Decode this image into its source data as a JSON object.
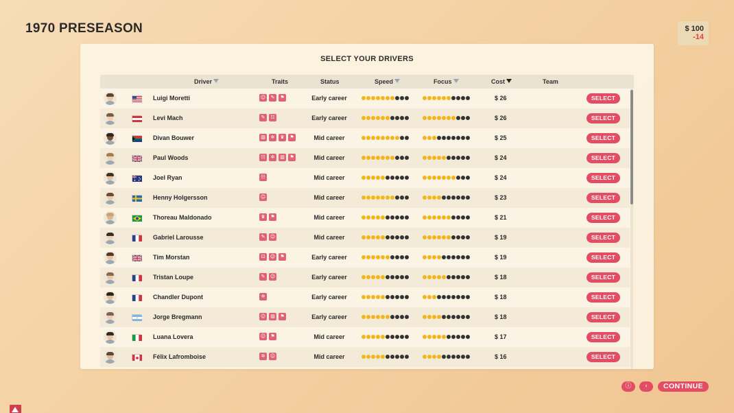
{
  "page": {
    "title": "1970 PRESEASON"
  },
  "money": {
    "balance": "$ 100",
    "delta": "-14",
    "delta_color": "#e53e3e"
  },
  "panel": {
    "title": "SELECT YOUR DRIVERS"
  },
  "columns": {
    "driver": "Driver",
    "traits": "Traits",
    "status": "Status",
    "speed": "Speed",
    "focus": "Focus",
    "cost": "Cost",
    "team": "Team"
  },
  "sort": {
    "active_column": "cost"
  },
  "select_label": "SELECT",
  "max_rating": 10,
  "accent_color": "#e34d63",
  "rating_on_color": "#f4b51c",
  "drivers": [
    {
      "name": "Luigi Moretti",
      "country": "USA",
      "traits": [
        "smile",
        "wrench",
        "flag"
      ],
      "status": "Early career",
      "speed": 7,
      "focus": 6,
      "cost": "$ 26"
    },
    {
      "name": "Levi Mach",
      "country": "Austria",
      "traits": [
        "wrench",
        "ghost"
      ],
      "status": "Early career",
      "speed": 6,
      "focus": 7,
      "cost": "$ 26"
    },
    {
      "name": "Divan Bouwer",
      "country": "South Africa",
      "traits": [
        "chart",
        "gear",
        "trophy",
        "flag"
      ],
      "status": "Mid career",
      "speed": 8,
      "focus": 3,
      "cost": "$ 25"
    },
    {
      "name": "Paul Woods",
      "country": "UK",
      "traits": [
        "ghost",
        "gear",
        "chart",
        "flag"
      ],
      "status": "Mid career",
      "speed": 7,
      "focus": 5,
      "cost": "$ 24"
    },
    {
      "name": "Joel Ryan",
      "country": "Australia",
      "traits": [
        "ghost"
      ],
      "status": "Mid career",
      "speed": 5,
      "focus": 7,
      "cost": "$ 24"
    },
    {
      "name": "Henny Holgersson",
      "country": "Sweden",
      "traits": [
        "smile"
      ],
      "status": "Mid career",
      "speed": 7,
      "focus": 4,
      "cost": "$ 23"
    },
    {
      "name": "Thoreau Maldonado",
      "country": "Brazil",
      "traits": [
        "trophy",
        "flag"
      ],
      "status": "Mid career",
      "speed": 5,
      "focus": 6,
      "cost": "$ 21"
    },
    {
      "name": "Gabriel Larousse",
      "country": "France",
      "traits": [
        "wrench",
        "smile"
      ],
      "status": "Mid career",
      "speed": 5,
      "focus": 6,
      "cost": "$ 19"
    },
    {
      "name": "Tim Morstan",
      "country": "UK",
      "traits": [
        "tag",
        "smile",
        "flag"
      ],
      "status": "Early career",
      "speed": 6,
      "focus": 4,
      "cost": "$ 19"
    },
    {
      "name": "Tristan Loupe",
      "country": "France",
      "traits": [
        "wrench",
        "smile"
      ],
      "status": "Early career",
      "speed": 5,
      "focus": 5,
      "cost": "$ 18"
    },
    {
      "name": "Chandler Dupont",
      "country": "France",
      "traits": [
        "gear"
      ],
      "status": "Early career",
      "speed": 5,
      "focus": 3,
      "cost": "$ 18"
    },
    {
      "name": "Jorge Bregmann",
      "country": "Argentina",
      "traits": [
        "smile",
        "chart",
        "flag"
      ],
      "status": "Early career",
      "speed": 6,
      "focus": 4,
      "cost": "$ 18"
    },
    {
      "name": "Luana Lovera",
      "country": "Italy",
      "traits": [
        "smile",
        "flag"
      ],
      "status": "Mid career",
      "speed": 5,
      "focus": 5,
      "cost": "$ 17"
    },
    {
      "name": "Félix Lafromboise",
      "country": "Canada",
      "traits": [
        "gear",
        "smile"
      ],
      "status": "Mid career",
      "speed": 5,
      "focus": 4,
      "cost": "$ 16"
    }
  ],
  "footer": {
    "info_icon": "info-icon",
    "back_icon": "back-arrow-icon",
    "continue_label": "CONTINUE"
  },
  "corner": {
    "icon": "alert-triangle-icon"
  }
}
